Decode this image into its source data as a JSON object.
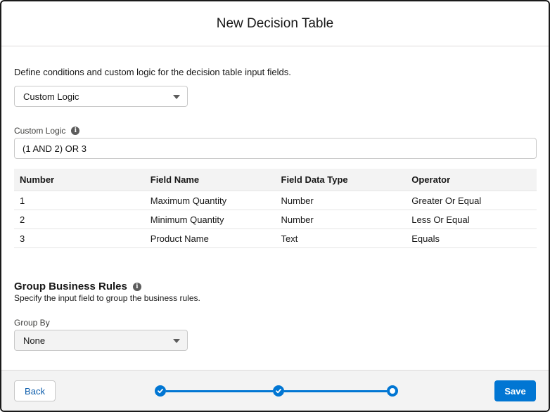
{
  "modal": {
    "title": "New Decision Table"
  },
  "conditions": {
    "intro": "Define conditions and custom logic for the decision table input fields.",
    "logic_type": "Custom Logic",
    "custom_logic_label": "Custom Logic",
    "custom_logic_value": "(1 AND 2) OR 3",
    "info_glyph": "i"
  },
  "table": {
    "headers": [
      "Number",
      "Field Name",
      "Field Data Type",
      "Operator"
    ],
    "rows": [
      [
        "1",
        "Maximum Quantity",
        "Number",
        "Greater Or Equal"
      ],
      [
        "2",
        "Minimum Quantity",
        "Number",
        "Less Or Equal"
      ],
      [
        "3",
        "Product Name",
        "Text",
        "Equals"
      ]
    ]
  },
  "group": {
    "title": "Group Business Rules",
    "subtitle": "Specify the input field to group the business rules.",
    "group_by_label": "Group By",
    "group_by_value": "None"
  },
  "footer": {
    "back_label": "Back",
    "save_label": "Save",
    "progress": {
      "steps": 3,
      "completed": 2,
      "current": 3
    }
  },
  "colors": {
    "brand": "#0176d3",
    "link": "#0b5cab",
    "footer_bg": "#f3f3f3"
  }
}
